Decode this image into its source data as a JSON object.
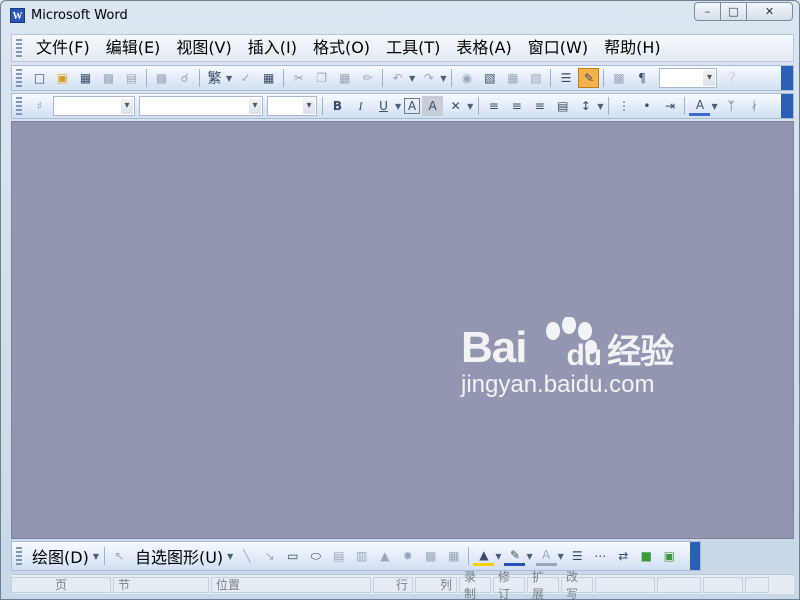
{
  "window": {
    "title": "Microsoft Word",
    "app_icon_letter": "W"
  },
  "window_controls": {
    "minimize": "–",
    "maximize": "□",
    "close": "✕"
  },
  "menu": {
    "items": [
      "文件(F)",
      "编辑(E)",
      "视图(V)",
      "插入(I)",
      "格式(O)",
      "工具(T)",
      "表格(A)",
      "窗口(W)",
      "帮助(H)"
    ]
  },
  "standard_toolbar": {
    "icons": [
      "new-document-icon",
      "open-icon",
      "save-icon",
      "permission-icon",
      "print-preview-icon",
      "print-icon",
      "research-icon",
      "spelling-icon",
      "cut-icon",
      "copy-icon",
      "paste-icon",
      "format-painter-icon",
      "undo-icon",
      "redo-icon",
      "hyperlink-icon",
      "tables-borders-icon",
      "insert-table-icon",
      "insert-excel-icon",
      "columns-icon",
      "drawing-icon",
      "document-map-icon",
      "show-hide-icon",
      "help-icon"
    ],
    "traditional_char": "繁",
    "zoom_value": ""
  },
  "formatting_toolbar": {
    "style_value": "",
    "font_value": "",
    "size_value": "",
    "bold": "B",
    "italic": "I",
    "underline": "U",
    "char_border": "A",
    "char_shading": "A",
    "font_color": "A"
  },
  "drawing_toolbar": {
    "draw_label": "绘图(D)",
    "autoshapes_label": "自选图形(U)"
  },
  "status_bar": {
    "page": "页",
    "section": "节",
    "position": "位置",
    "line": "行",
    "column": "列",
    "rec": "录制",
    "trk": "修订",
    "ext": "扩展",
    "ovr": "改写"
  },
  "watermark": {
    "brand": "Bai",
    "brand2": "du",
    "cn": "经验",
    "url": "jingyan.baidu.com"
  },
  "colors": {
    "document_bg": "#9396b0",
    "toolbar_accent": "#2c5fb8",
    "active_button": "#f3b24b"
  }
}
